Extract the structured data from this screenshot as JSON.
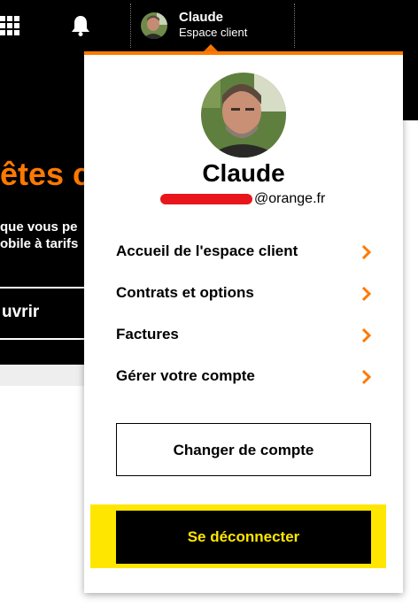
{
  "header": {
    "user_name": "Claude",
    "user_subtitle": "Espace client"
  },
  "background_page": {
    "headline": "êtes c",
    "text_line1": "que vous pe",
    "text_line2": "obile à tarifs",
    "discover_button": "uvrir"
  },
  "dropdown": {
    "name": "Claude",
    "email_domain": "@orange.fr",
    "menu": [
      {
        "label": "Accueil de l'espace client"
      },
      {
        "label": "Contrats et options"
      },
      {
        "label": "Factures"
      },
      {
        "label": "Gérer votre compte"
      }
    ],
    "switch_account_label": "Changer de compte",
    "logout_label": "Se déconnecter"
  },
  "colors": {
    "brand_orange": "#ff7900",
    "highlight_yellow": "#ffe600",
    "redaction_red": "#e8161b",
    "black": "#000000"
  },
  "icons": [
    "apps-grid-icon",
    "bell-icon",
    "chevron-right-icon"
  ]
}
